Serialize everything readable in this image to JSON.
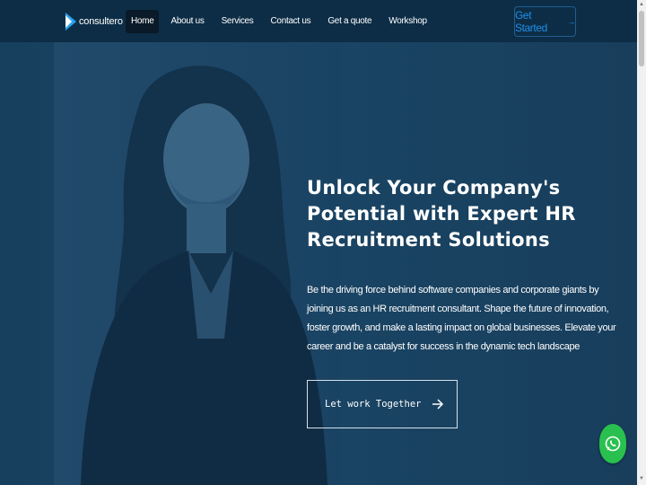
{
  "brand": {
    "name": "consultero"
  },
  "nav": {
    "items": [
      {
        "label": "Home",
        "active": true
      },
      {
        "label": "About us",
        "active": false
      },
      {
        "label": "Services",
        "active": false
      },
      {
        "label": "Contact us",
        "active": false
      },
      {
        "label": "Get a quote",
        "active": false
      },
      {
        "label": "Workshop",
        "active": false
      }
    ],
    "cta_label": "Get Started",
    "cta_icon": "arrow-right-icon"
  },
  "hero": {
    "title": "Unlock Your Company's Potential with Expert HR Recruitment Solutions",
    "description": "Be the driving force behind software companies and corporate giants by joining us as an HR recruitment consultant. Shape the future of innovation, foster growth, and make a lasting impact on global businesses. Elevate your career and be a catalyst for success in the dynamic tech landscape",
    "button_label": "Let work Together",
    "button_icon": "arrow-right-icon",
    "background_image": "woman-portrait-photo"
  },
  "floating": {
    "icon": "whatsapp-icon"
  },
  "colors": {
    "navbar": "#0d2d46",
    "hero_overlay": "#17405e",
    "cta_text": "#1e8fe8",
    "whatsapp": "#29c04f"
  }
}
